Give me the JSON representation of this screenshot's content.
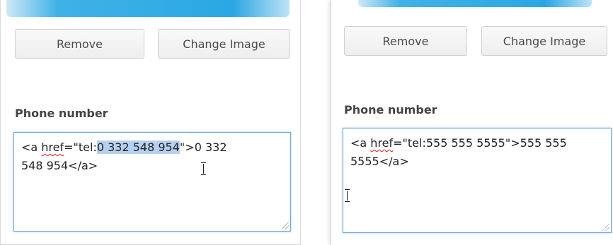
{
  "left": {
    "remove_label": "Remove",
    "change_image_label": "Change Image",
    "phone_label": "Phone number",
    "field": {
      "a_open": "<a ",
      "href_word": "href",
      "href_prefix": "=\"tel:",
      "selected_number": "0 332 548 954",
      "href_suffix": "\">0 332",
      "line2": "548 954</a>"
    }
  },
  "right": {
    "remove_label": "Remove",
    "change_image_label": "Change Image",
    "phone_label": "Phone number",
    "field": {
      "a_open": "<a ",
      "href_word": "href",
      "rest_line1": "=\"tel:555 555 5555\">555 555",
      "line2": "5555</a>"
    }
  },
  "colors": {
    "accent_bar": "#2aa7e3",
    "selection": "#b5d1ef",
    "focus_border": "#6fa3d8"
  }
}
